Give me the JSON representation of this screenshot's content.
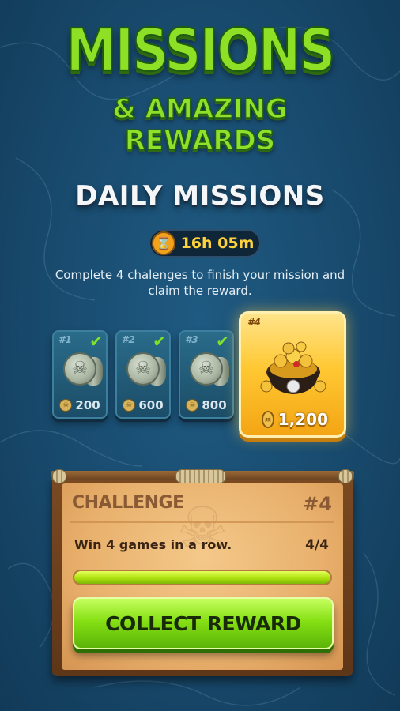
{
  "header": {
    "title": "MISSIONS",
    "subtitle_line1": "& AMAZING",
    "subtitle_line2": "REWARDS",
    "section": "DAILY MISSIONS"
  },
  "timer": {
    "icon": "hourglass-icon",
    "value": "16h 05m"
  },
  "description": "Complete 4 chalenges to finish your mission and claim the reward.",
  "rewards": [
    {
      "label": "#1",
      "amount": "200",
      "completed": true,
      "icon": "silver-coin-stack-icon"
    },
    {
      "label": "#2",
      "amount": "600",
      "completed": true,
      "icon": "silver-coin-stack-icon"
    },
    {
      "label": "#3",
      "amount": "800",
      "completed": true,
      "icon": "silver-coin-stack-icon"
    },
    {
      "label": "#4",
      "amount": "1,200",
      "completed": false,
      "icon": "treasure-pot-icon"
    }
  ],
  "challenge": {
    "label": "CHALLENGE",
    "number": "#4",
    "text": "Win 4 games in a row.",
    "progress": "4/4",
    "progress_fraction": 1.0,
    "button": "COLLECT REWARD"
  },
  "colors": {
    "background": "#184a6d",
    "title_green": "#8de026",
    "timer_text": "#ffd23c",
    "button_green": "#86e014",
    "parchment": "#e8b06c"
  }
}
